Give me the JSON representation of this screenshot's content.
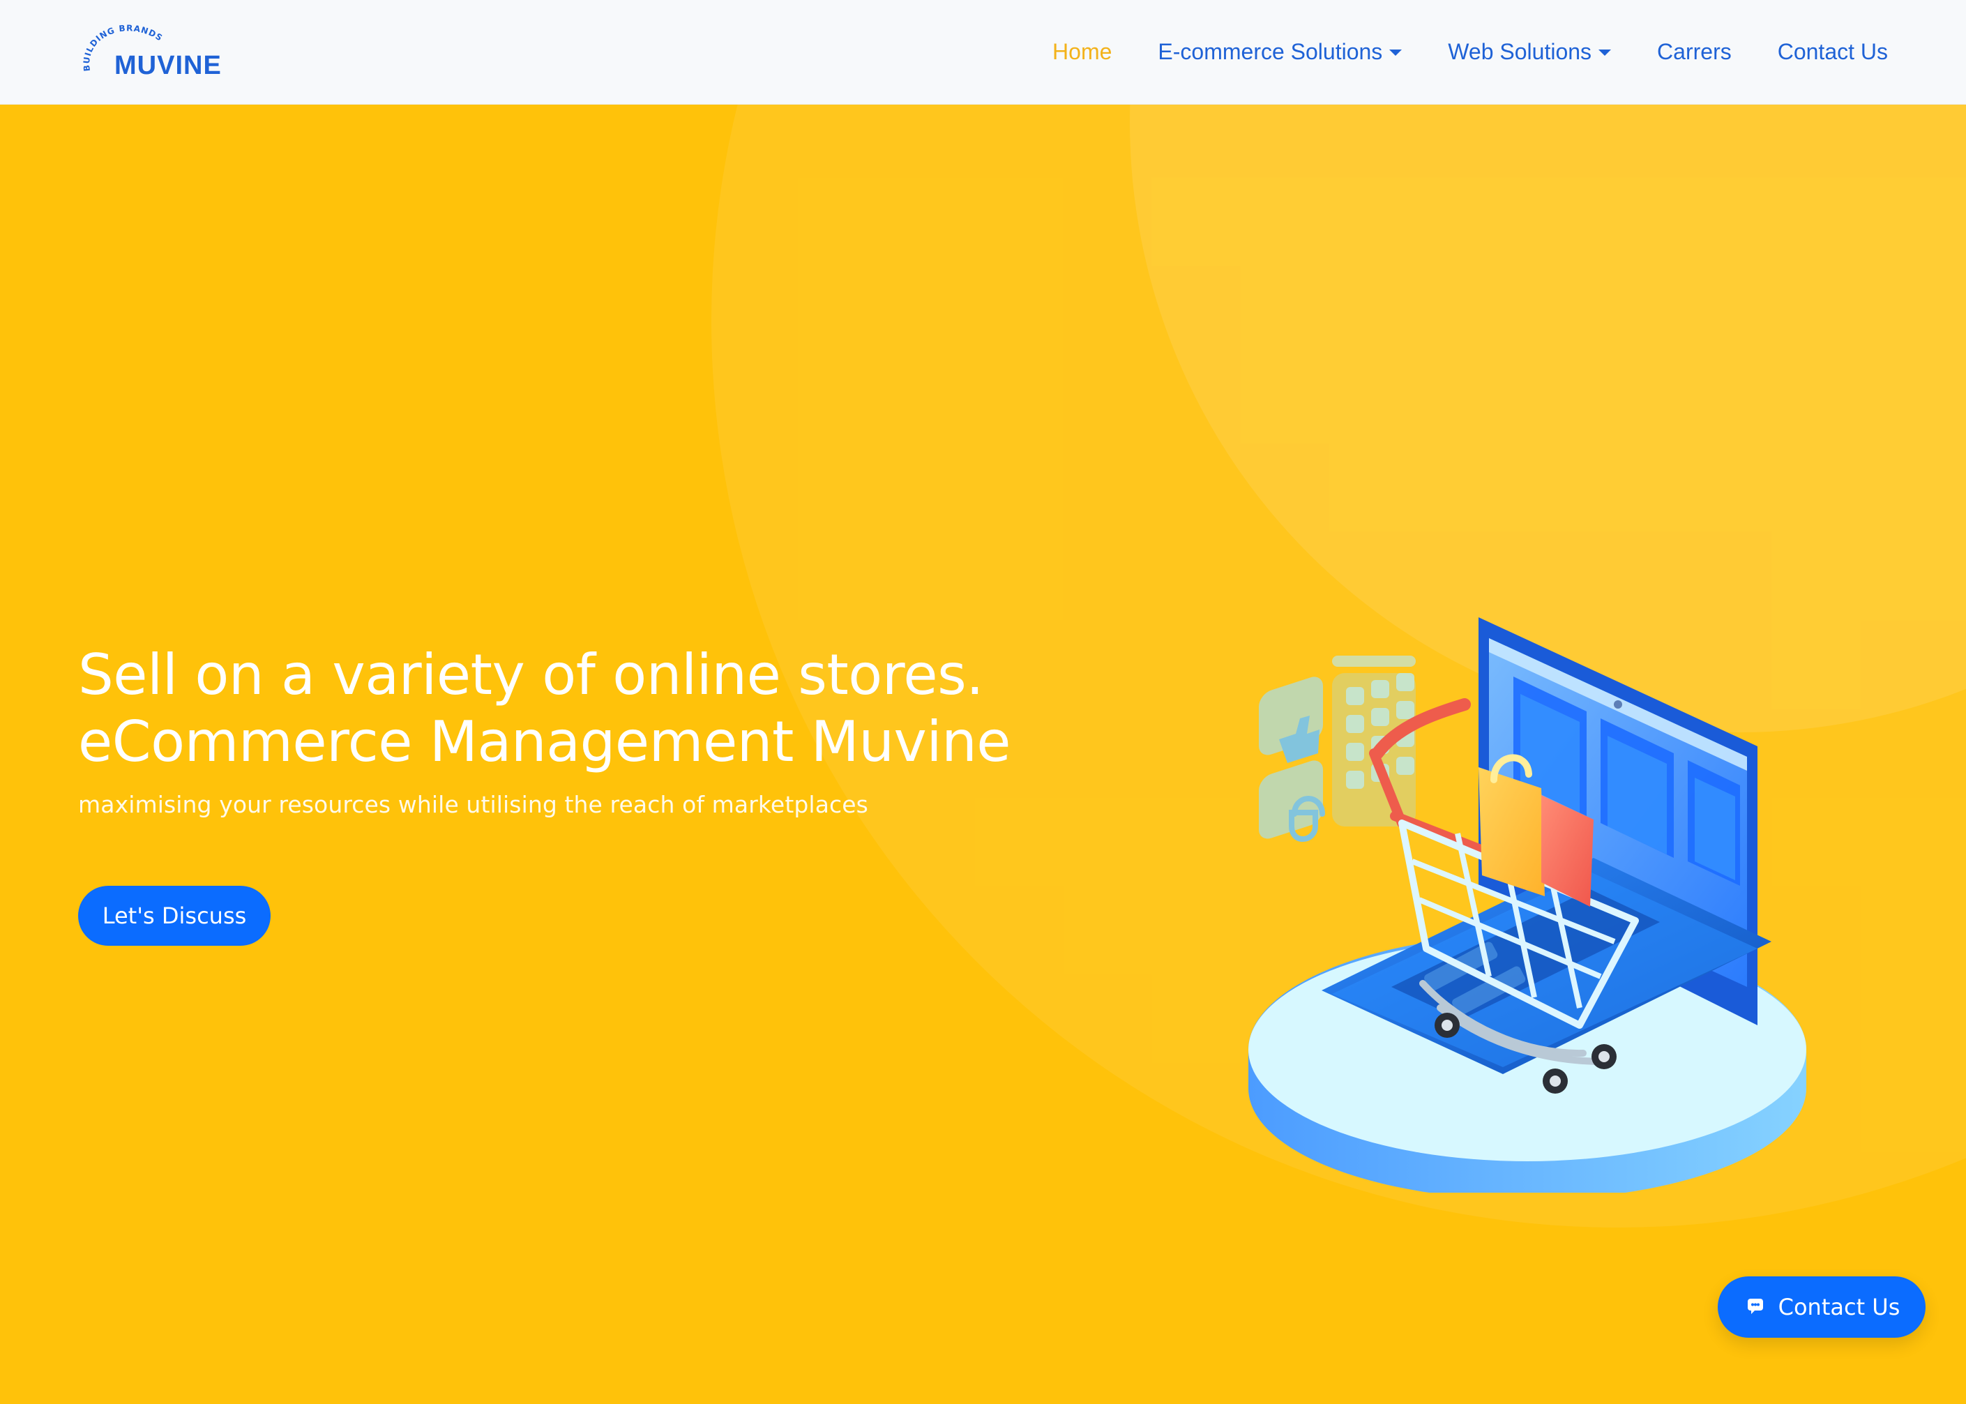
{
  "brand": {
    "tagline_arc": "BUILDING BRANDS",
    "name": "MUVINE"
  },
  "nav": {
    "items": [
      {
        "label": "Home",
        "active": true,
        "dropdown": false
      },
      {
        "label": "E-commerce Solutions",
        "active": false,
        "dropdown": true
      },
      {
        "label": "Web Solutions",
        "active": false,
        "dropdown": true
      },
      {
        "label": "Carrers",
        "active": false,
        "dropdown": false
      },
      {
        "label": "Contact Us",
        "active": false,
        "dropdown": false
      }
    ]
  },
  "hero": {
    "title_line_1": "Sell on a variety of online stores.",
    "title_line_2": "eCommerce Management Muvine",
    "subtitle": "maximising your resources while utilising the reach of marketplaces",
    "cta_label": "Let's Discuss"
  },
  "floating_contact": {
    "label": "Contact Us",
    "icon": "chat-bubble-icon"
  },
  "colors": {
    "background_yellow": "#FFC20A",
    "accent_blue": "#0B6CFF",
    "nav_background": "#F7F9FB",
    "nav_text_blue": "#1F62D6",
    "nav_active_yellow": "#F3B21A"
  }
}
